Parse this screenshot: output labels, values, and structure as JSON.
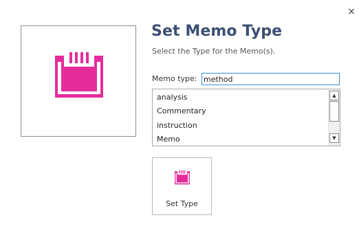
{
  "dialog": {
    "close_symbol": "×",
    "title": "Set Memo Type",
    "subtitle": "Select the Type for the Memo(s).",
    "accent_color": "#e52c9b",
    "title_color": "#3b4f73"
  },
  "memo_type": {
    "label": "Memo type:",
    "value": "method"
  },
  "type_list": {
    "items": [
      "analysis",
      "Commentary",
      "instruction",
      "Memo"
    ]
  },
  "actions": {
    "set_type_label": "Set Type"
  },
  "icons": {
    "preview": "memo-type-icon",
    "button": "memo-type-icon"
  }
}
